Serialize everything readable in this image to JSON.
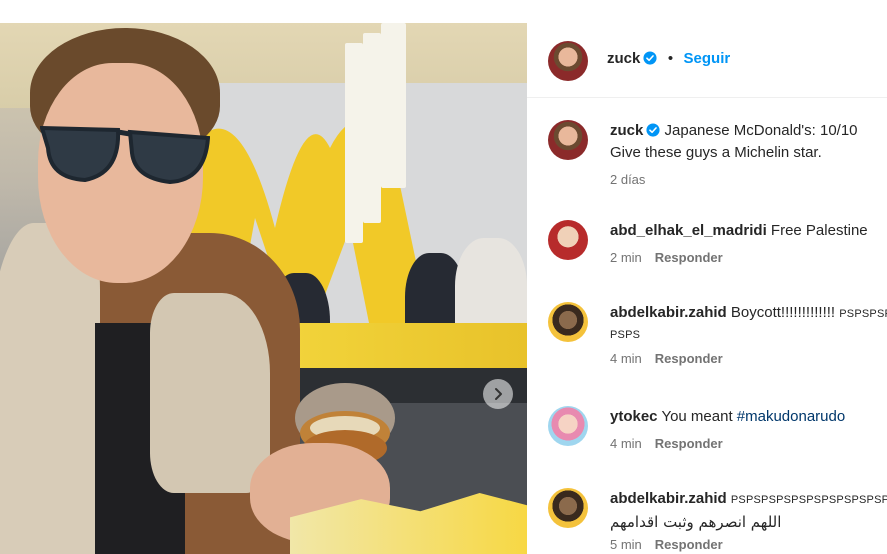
{
  "post": {
    "header": {
      "username": "zuck",
      "separator": "•",
      "follow_label": "Seguir"
    },
    "caption": {
      "username": "zuck",
      "line1": "Japanese McDonald's: 10/10",
      "line2": "Give these guys a Michelin star.",
      "age": "2 días"
    }
  },
  "comments": [
    {
      "username": "abd_elhak_el_madridi",
      "text": "Free Palestine",
      "age": "2 min",
      "reply_label": "Responder"
    },
    {
      "username": "abdelkabir.zahid",
      "text": "Boycott!!!!!!!!!!!!!",
      "text_small": "PSPSPSPSPS",
      "line2": "PSPS",
      "age": "4 min",
      "reply_label": "Responder"
    },
    {
      "username": "ytokec",
      "text": "You meant ",
      "hashtag": "#makudonarudo",
      "age": "4 min",
      "reply_label": "Responder"
    },
    {
      "username": "abdelkabir.zahid",
      "text_small": "PSPSPSPSPSPSPSPSPSPSPS",
      "line2": "اللهم انصرهم وثبت اقدامهم",
      "age": "5 min",
      "reply_label": "Responder"
    }
  ],
  "colors": {
    "accent_link": "#0095f6",
    "verified_badge": "#0095f6",
    "hashtag": "#00376b",
    "muted_text": "#737373"
  },
  "icons": {
    "verified": "verified-badge-icon",
    "next": "chevron-right-icon"
  }
}
